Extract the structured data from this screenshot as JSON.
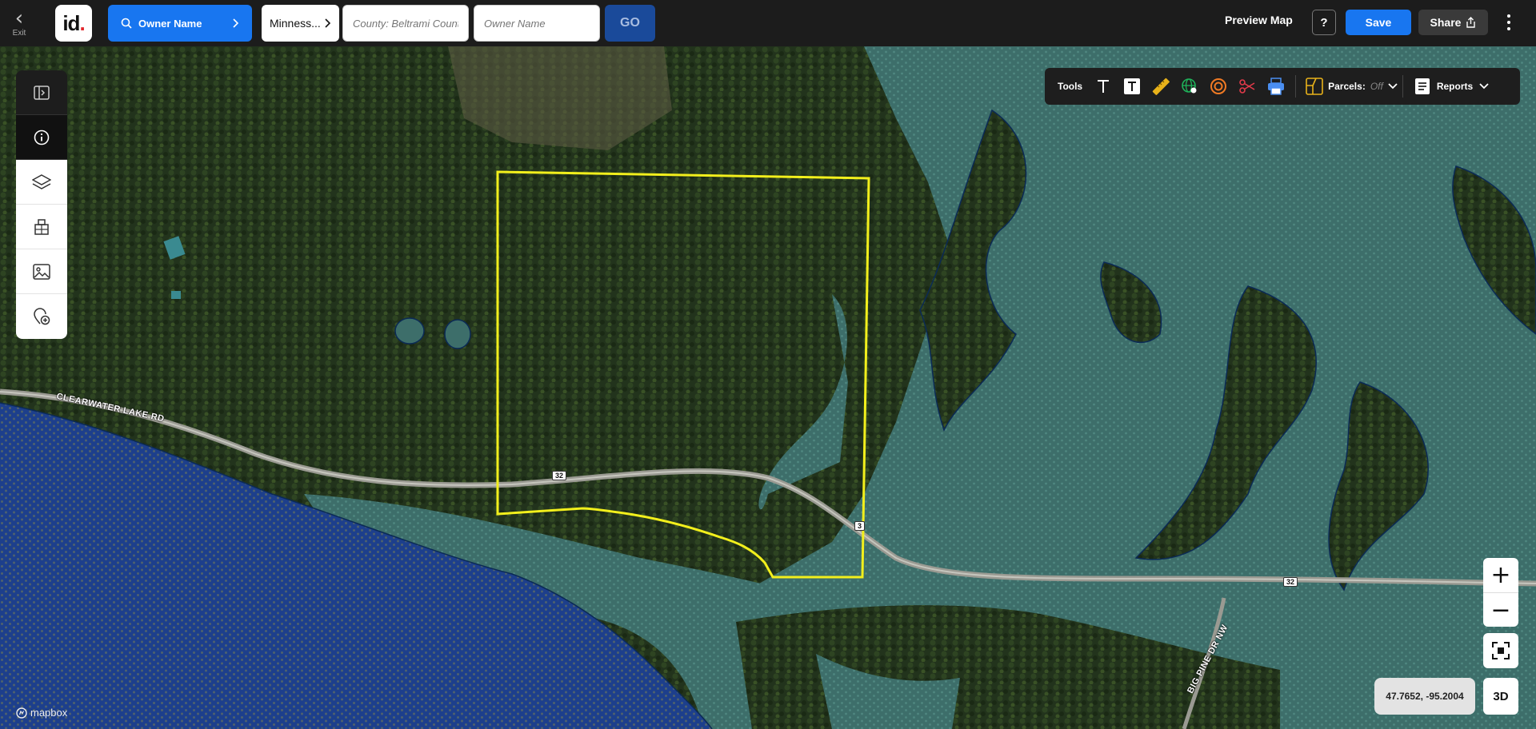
{
  "topbar": {
    "exit_label": "Exit",
    "logo_text": "id",
    "search_type_label": "Owner Name",
    "state_label": "Minness...",
    "county_placeholder": "County: Beltrami County",
    "owner_placeholder": "Owner Name",
    "go_label": "GO",
    "preview_map_label": "Preview Map",
    "help_label": "?",
    "save_label": "Save",
    "share_label": "Share"
  },
  "toolbar": {
    "tools_label": "Tools",
    "parcels_label": "Parcels:",
    "parcels_state": "Off",
    "reports_label": "Reports",
    "icons": [
      "text-tool-icon",
      "text-box-tool-icon",
      "measure-ruler-icon",
      "globe-pin-icon",
      "radius-circle-icon",
      "scissors-icon",
      "print-icon",
      "parcel-layer-icon",
      "reports-icon"
    ]
  },
  "left_panel": {
    "icons": [
      "sidebar-expand-icon",
      "info-icon",
      "layers-icon",
      "building-icon",
      "image-icon",
      "add-location-icon"
    ]
  },
  "map": {
    "road_name_1": "CLEARWATER LAKE RD",
    "road_name_2": "BIG PINE DR NW",
    "route_number": "32",
    "route_number_partial": "3",
    "coordinates": "47.7652, -95.2004",
    "view_3d_label": "3D",
    "zoom_in": "+",
    "zoom_out": "−",
    "attribution": "mapbox",
    "parcel_outline_color": "#f2ef1c",
    "water_color": "#1d3f8c",
    "wetland_color": "#3f7f80"
  }
}
